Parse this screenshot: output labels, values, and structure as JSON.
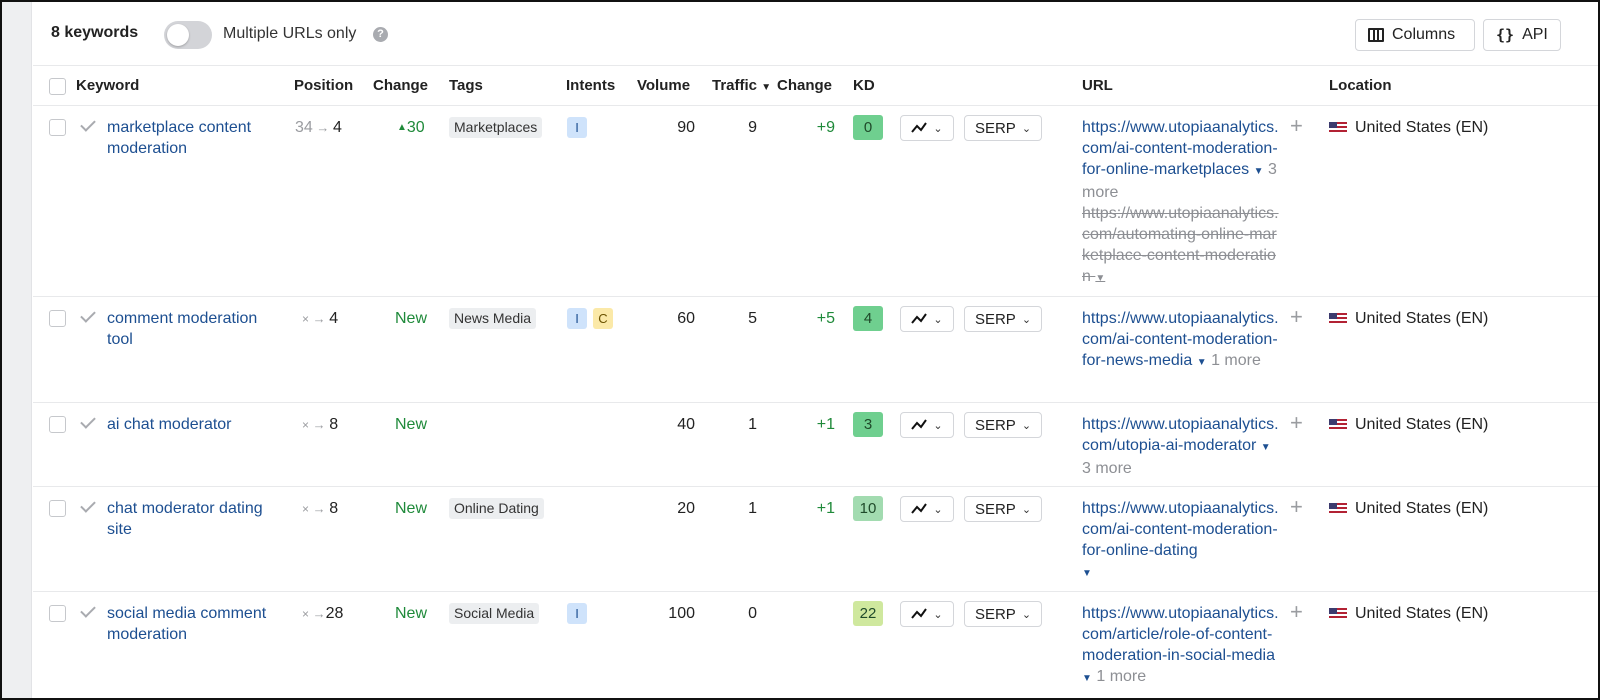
{
  "toolbar": {
    "keyword_count": "8 keywords",
    "toggle_label": "Multiple URLs only",
    "toggle_on": false,
    "columns_label": "Columns",
    "api_label": "API"
  },
  "columns": {
    "keyword": "Keyword",
    "position": "Position",
    "change": "Change",
    "tags": "Tags",
    "intents": "Intents",
    "volume": "Volume",
    "traffic": "Traffic",
    "traffic_change": "Change",
    "kd": "KD",
    "url": "URL",
    "location": "Location"
  },
  "serp_label": "SERP",
  "rows": [
    {
      "keyword": "marketplace content moderation",
      "prev_position": "34",
      "position": "4",
      "change": "30",
      "tag": "Marketplaces",
      "intents": [
        "I"
      ],
      "volume": "90",
      "traffic": "9",
      "traffic_change": "+9",
      "kd": "0",
      "url": "https://www.utopiaanalytics.com/ai-content-moderation-for-online-marketplaces",
      "url_more": "3 more",
      "url_old": "https://www.utopiaanalytics.com/automating-online-marketplace-content-moderation",
      "location": "United States (EN)"
    },
    {
      "keyword": "comment moderation tool",
      "prev_position": "×",
      "position": "4",
      "change": "New",
      "tag": "News Media",
      "intents": [
        "I",
        "C"
      ],
      "volume": "60",
      "traffic": "5",
      "traffic_change": "+5",
      "kd": "4",
      "url": "https://www.utopiaanalytics.com/ai-content-moderation-for-news-media",
      "url_more": "1 more",
      "location": "United States (EN)"
    },
    {
      "keyword": "ai chat moderator",
      "prev_position": "×",
      "position": "8",
      "change": "New",
      "tag": "",
      "intents": [],
      "volume": "40",
      "traffic": "1",
      "traffic_change": "+1",
      "kd": "3",
      "url": "https://www.utopiaanalytics.com/utopia-ai-moderator",
      "url_more": "3 more",
      "location": "United States (EN)"
    },
    {
      "keyword": "chat moderator dating site",
      "prev_position": "×",
      "position": "8",
      "change": "New",
      "tag": "Online Dating",
      "intents": [],
      "volume": "20",
      "traffic": "1",
      "traffic_change": "+1",
      "kd": "10",
      "url": "https://www.utopiaanalytics.com/ai-content-moderation-for-online-dating",
      "url_more": "",
      "location": "United States (EN)"
    },
    {
      "keyword": "social media comment moderation",
      "prev_position": "×",
      "position": "28",
      "change": "New",
      "tag": "Social Media",
      "intents": [
        "I"
      ],
      "volume": "100",
      "traffic": "0",
      "traffic_change": "",
      "kd": "22",
      "url": "https://www.utopiaanalytics.com/article/role-of-content-moderation-in-social-media",
      "url_more": "1 more",
      "location": "United States (EN)"
    }
  ],
  "colors": {
    "link": "#1d4f91",
    "green": "#1f8a3a",
    "kd_dark": "#6fcf8f",
    "kd_mid": "#a2dbb0",
    "kd_light": "#cfe89e"
  }
}
